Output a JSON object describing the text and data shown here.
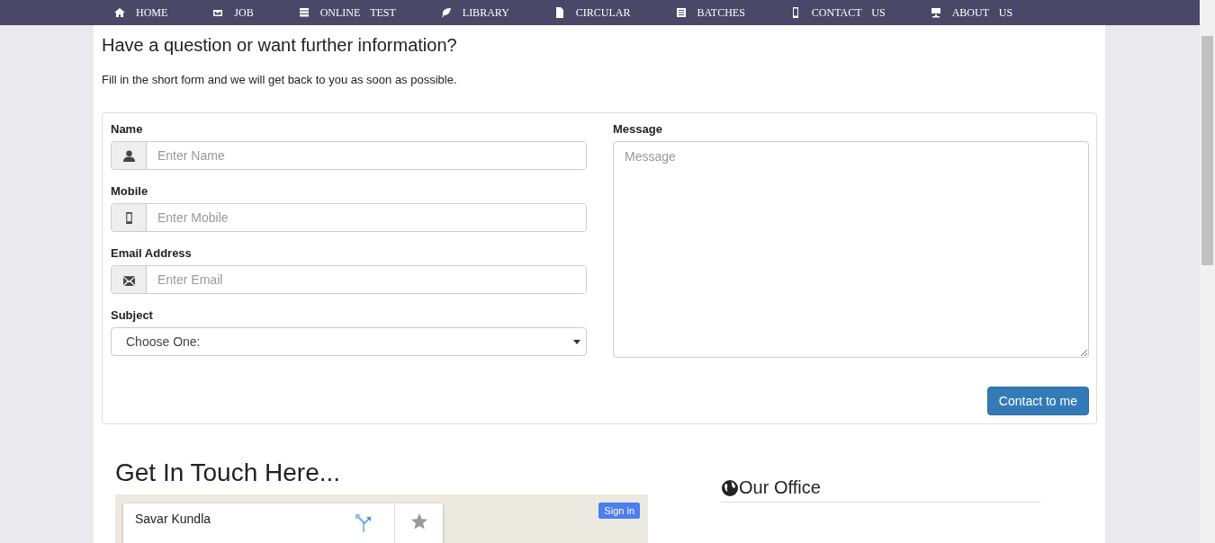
{
  "nav": {
    "items": [
      {
        "label": "HOME"
      },
      {
        "label": "JOB"
      },
      {
        "label": "ONLINE TEST"
      },
      {
        "label": "LIBRARY"
      },
      {
        "label": "CIRCULAR"
      },
      {
        "label": "BATCHES"
      },
      {
        "label": "CONTACT US"
      },
      {
        "label": "ABOUT US"
      }
    ]
  },
  "contact": {
    "heading": "Have a question or want further information?",
    "intro": "Fill in the short form and we will get back to you as soon as possible.",
    "fields": [
      {
        "kind": "text",
        "label": "Name",
        "placeholder": "Enter Name"
      },
      {
        "kind": "text",
        "label": "Mobile",
        "placeholder": "Enter Mobile"
      },
      {
        "kind": "text",
        "label": "Email Address",
        "placeholder": "Enter Email"
      },
      {
        "kind": "select",
        "label": "Subject",
        "value": "Choose One:"
      }
    ],
    "message": {
      "label": "Message",
      "placeholder": "Message"
    },
    "submit": "Contact to me"
  },
  "touch": {
    "heading": "Get In Touch Here...",
    "map": {
      "place_name": "Savar Kundla",
      "sign_in": "Sign in"
    }
  },
  "office": {
    "heading": "Our Office"
  }
}
